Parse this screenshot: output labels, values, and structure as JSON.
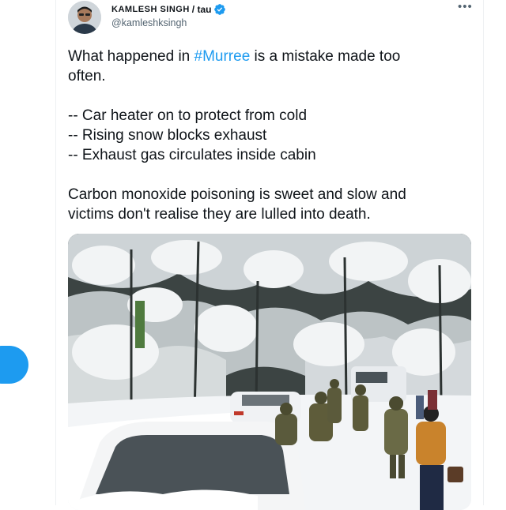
{
  "tweet": {
    "display_name": "KAMLESH SINGH",
    "name_suffix": "/ tau",
    "handle": "@kamleshksingh",
    "more_label": "•••",
    "para1_before": "What happened in ",
    "hashtag": "#Murree",
    "para1_after": " is a mistake made too",
    "para1_line2": "often.",
    "bullets": [
      "-- Car heater on to protect from cold",
      "-- Rising snow blocks exhaust",
      "-- Exhaust gas circulates inside cabin"
    ],
    "para3_line1": "Carbon monoxide poisoning is sweet and slow and",
    "para3_line2": "victims don't realise they are lulled into death."
  },
  "colors": {
    "accent": "#1d9bf0",
    "text": "#0f1419",
    "secondary": "#536471"
  },
  "icons": {
    "verified": "verified-badge-icon",
    "more": "more-horizontal-icon"
  }
}
